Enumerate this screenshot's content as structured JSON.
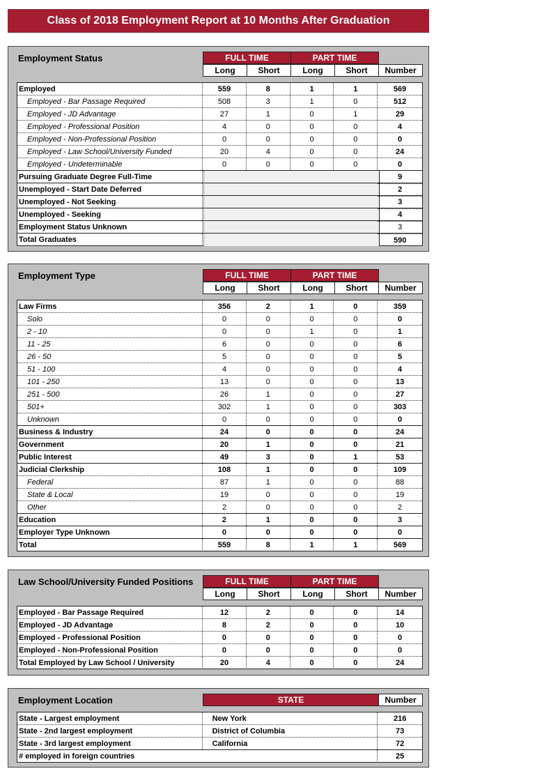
{
  "title": "Class of 2018 Employment Report at 10 Months After Graduation",
  "colors": {
    "accent": "#a61c30",
    "section_bg": "#c0c0c0",
    "blank_block": "#f0f0f0"
  },
  "headers": {
    "full_time": "FULL TIME",
    "part_time": "PART TIME",
    "long": "Long",
    "short": "Short",
    "number": "Number",
    "state": "STATE"
  },
  "employment_status": {
    "title": "Employment Status",
    "rows": [
      {
        "label": "Employed",
        "values": [
          "559",
          "8",
          "1",
          "1",
          "569"
        ],
        "style": "bold"
      },
      {
        "label": "Employed - Bar Passage Required",
        "values": [
          "508",
          "3",
          "1",
          "0",
          "512"
        ],
        "style": "indent"
      },
      {
        "label": "Employed - JD Advantage",
        "values": [
          "27",
          "1",
          "0",
          "1",
          "29"
        ],
        "style": "indent"
      },
      {
        "label": "Employed - Professional Position",
        "values": [
          "4",
          "0",
          "0",
          "0",
          "4"
        ],
        "style": "indent"
      },
      {
        "label": "Employed - Non-Professional Position",
        "values": [
          "0",
          "0",
          "0",
          "0",
          "0"
        ],
        "style": "indent"
      },
      {
        "label": "Employed - Law School/University Funded",
        "values": [
          "20",
          "4",
          "0",
          "0",
          "24"
        ],
        "style": "indent"
      },
      {
        "label": "Employed - Undeterminable",
        "values": [
          "0",
          "0",
          "0",
          "0",
          "0"
        ],
        "style": "indent"
      }
    ],
    "other_rows": [
      {
        "label": "Pursuing Graduate Degree Full-Time",
        "number": "9"
      },
      {
        "label": "Unemployed - Start Date Deferred",
        "number": "2"
      },
      {
        "label": "Unemployed - Not Seeking",
        "number": "3"
      },
      {
        "label": "Unemployed - Seeking",
        "number": "4"
      },
      {
        "label": "Employment Status Unknown",
        "number": "3"
      },
      {
        "label": "Total Graduates",
        "number": "590"
      }
    ]
  },
  "employment_type": {
    "title": "Employment Type",
    "rows": [
      {
        "label": "Law Firms",
        "values": [
          "356",
          "2",
          "1",
          "0",
          "359"
        ],
        "style": "bold"
      },
      {
        "label": "Solo",
        "values": [
          "0",
          "0",
          "0",
          "0",
          "0"
        ],
        "style": "indent"
      },
      {
        "label": "2 - 10",
        "values": [
          "0",
          "0",
          "1",
          "0",
          "1"
        ],
        "style": "indent"
      },
      {
        "label": "11 - 25",
        "values": [
          "6",
          "0",
          "0",
          "0",
          "6"
        ],
        "style": "indent"
      },
      {
        "label": "26 - 50",
        "values": [
          "5",
          "0",
          "0",
          "0",
          "5"
        ],
        "style": "indent"
      },
      {
        "label": "51 - 100",
        "values": [
          "4",
          "0",
          "0",
          "0",
          "4"
        ],
        "style": "indent"
      },
      {
        "label": "101 - 250",
        "values": [
          "13",
          "0",
          "0",
          "0",
          "13"
        ],
        "style": "indent"
      },
      {
        "label": "251 - 500",
        "values": [
          "26",
          "1",
          "0",
          "0",
          "27"
        ],
        "style": "indent"
      },
      {
        "label": "501+",
        "values": [
          "302",
          "1",
          "0",
          "0",
          "303"
        ],
        "style": "indent"
      },
      {
        "label": "Unknown",
        "values": [
          "0",
          "0",
          "0",
          "0",
          "0"
        ],
        "style": "indent"
      },
      {
        "label": "Business & Industry",
        "values": [
          "24",
          "0",
          "0",
          "0",
          "24"
        ],
        "style": "bold"
      },
      {
        "label": "Government",
        "values": [
          "20",
          "1",
          "0",
          "0",
          "21"
        ],
        "style": "bold"
      },
      {
        "label": "Public Interest",
        "values": [
          "49",
          "3",
          "0",
          "1",
          "53"
        ],
        "style": "bold"
      },
      {
        "label": "Judicial Clerkship",
        "values": [
          "108",
          "1",
          "0",
          "0",
          "109"
        ],
        "style": "bold"
      },
      {
        "label": "Federal",
        "values": [
          "87",
          "1",
          "0",
          "0",
          "88"
        ],
        "style": "indent"
      },
      {
        "label": "State & Local",
        "values": [
          "19",
          "0",
          "0",
          "0",
          "19"
        ],
        "style": "indent"
      },
      {
        "label": "Other",
        "values": [
          "2",
          "0",
          "0",
          "0",
          "2"
        ],
        "style": "indent"
      },
      {
        "label": "Education",
        "values": [
          "2",
          "1",
          "0",
          "0",
          "3"
        ],
        "style": "bold"
      },
      {
        "label": "Employer Type Unknown",
        "values": [
          "0",
          "0",
          "0",
          "0",
          "0"
        ],
        "style": "bold"
      },
      {
        "label": "Total",
        "values": [
          "559",
          "8",
          "1",
          "1",
          "569"
        ],
        "style": "bold"
      }
    ]
  },
  "funded_positions": {
    "title": "Law School/University Funded Positions",
    "rows": [
      {
        "label": "Employed - Bar Passage Required",
        "values": [
          "12",
          "2",
          "0",
          "0",
          "14"
        ]
      },
      {
        "label": "Employed - JD Advantage",
        "values": [
          "8",
          "2",
          "0",
          "0",
          "10"
        ]
      },
      {
        "label": "Employed - Professional Position",
        "values": [
          "0",
          "0",
          "0",
          "0",
          "0"
        ]
      },
      {
        "label": "Employed - Non-Professional Position",
        "values": [
          "0",
          "0",
          "0",
          "0",
          "0"
        ]
      },
      {
        "label": "Total Employed by Law School / University",
        "values": [
          "20",
          "4",
          "0",
          "0",
          "24"
        ]
      }
    ]
  },
  "employment_location": {
    "title": "Employment Location",
    "rows": [
      {
        "label": "State - Largest employment",
        "state": "New York",
        "number": "216"
      },
      {
        "label": "State - 2nd largest employment",
        "state": "District of Columbia",
        "number": "73"
      },
      {
        "label": "State - 3rd largest employment",
        "state": "California",
        "number": "72"
      }
    ],
    "foreign": {
      "label": "# employed in foreign countries",
      "number": "25"
    }
  }
}
